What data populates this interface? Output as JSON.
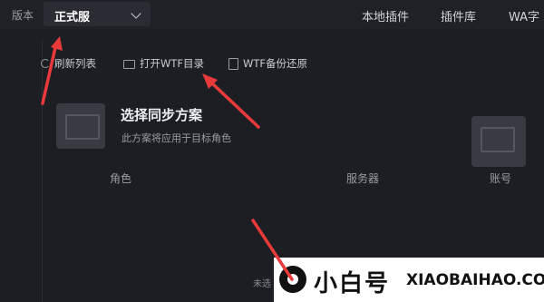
{
  "topbar": {
    "version_label": "版本",
    "version_value": "正式服",
    "nav": [
      "本地插件",
      "插件库",
      "WA字"
    ]
  },
  "toolbar": {
    "refresh": "刷新列表",
    "open_wtf": "打开WTF目录",
    "backup": "WTF备份还原"
  },
  "section": {
    "title": "选择同步方案",
    "subtitle": "此方案将应用于目标角色"
  },
  "columns": {
    "role": "角色",
    "server": "服务器",
    "account": "账号"
  },
  "footer": {
    "text": "未选"
  },
  "watermark": {
    "cn": "小白号",
    "en": "XIAOBAIHAO.COM"
  },
  "colors": {
    "arrow": "#e83a3a",
    "background": "#1d1e24"
  }
}
